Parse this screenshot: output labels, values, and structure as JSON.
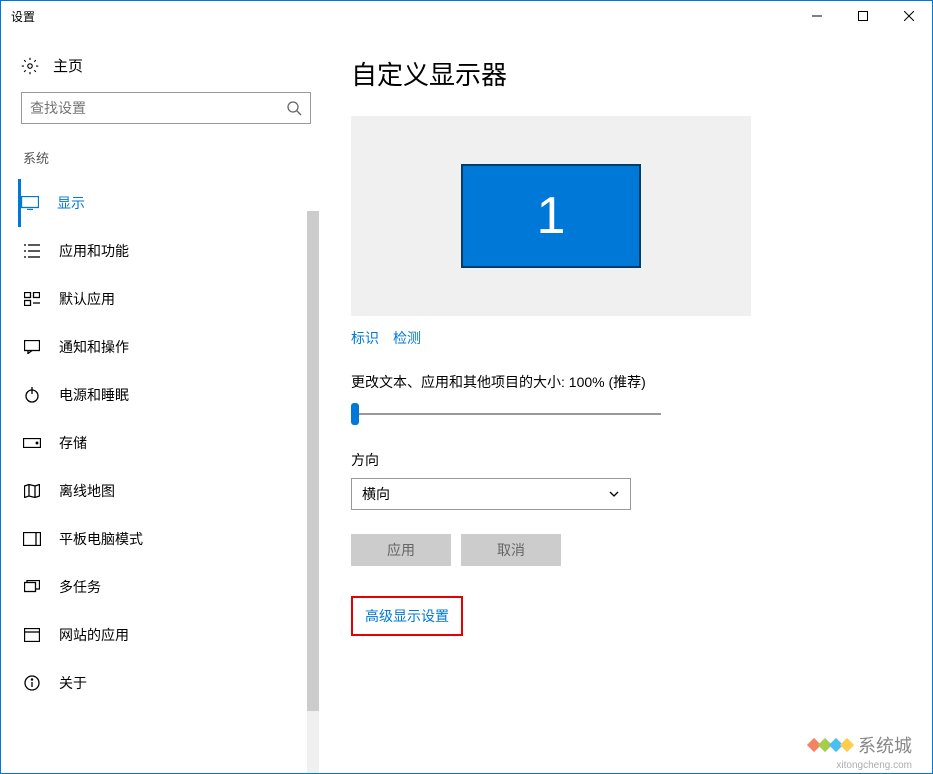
{
  "window": {
    "title": "设置"
  },
  "sidebar": {
    "home": "主页",
    "search_placeholder": "查找设置",
    "category": "系统",
    "items": [
      {
        "label": "显示",
        "active": true
      },
      {
        "label": "应用和功能"
      },
      {
        "label": "默认应用"
      },
      {
        "label": "通知和操作"
      },
      {
        "label": "电源和睡眠"
      },
      {
        "label": "存储"
      },
      {
        "label": "离线地图"
      },
      {
        "label": "平板电脑模式"
      },
      {
        "label": "多任务"
      },
      {
        "label": "网站的应用"
      },
      {
        "label": "关于"
      }
    ]
  },
  "main": {
    "title": "自定义显示器",
    "monitor_number": "1",
    "identify": "标识",
    "detect": "检测",
    "scale_label": "更改文本、应用和其他项目的大小: 100% (推荐)",
    "orientation_label": "方向",
    "orientation_value": "横向",
    "apply": "应用",
    "cancel": "取消",
    "advanced": "高级显示设置"
  },
  "watermark": {
    "text": "系统城",
    "url": "xitongcheng.com"
  }
}
